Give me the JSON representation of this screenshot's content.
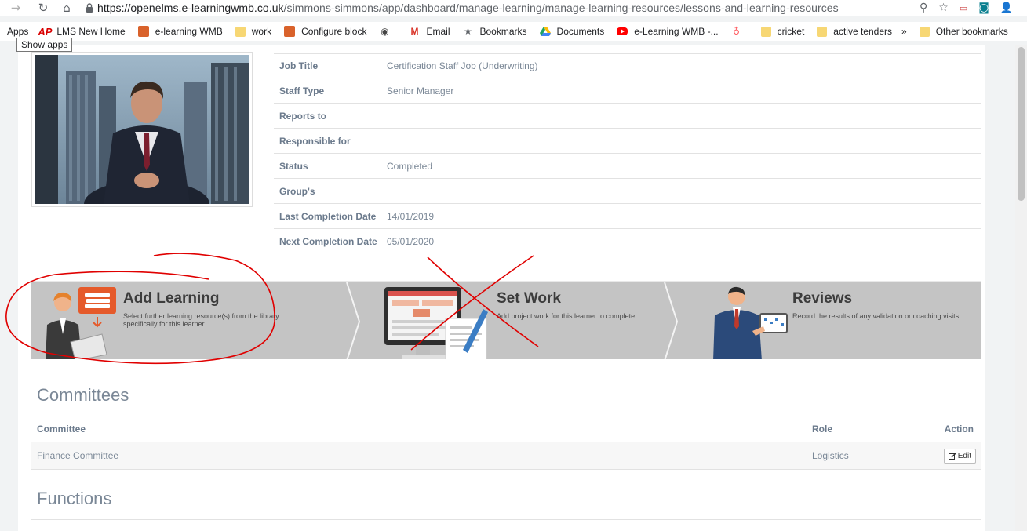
{
  "browser": {
    "url_host": "https://openelms.e-learningwmb.co.uk",
    "url_path": "/simmons-simmons/app/dashboard/manage-learning/manage-learning-resources/lessons-and-learning-resources",
    "bookmarks": [
      {
        "label": "Apps",
        "icon": "apps-icon"
      },
      {
        "label": "LMS New Home",
        "icon": "ap-logo-icon"
      },
      {
        "label": "e-learning WMB",
        "icon": "wmb-icon"
      },
      {
        "label": "work",
        "icon": "folder-icon"
      },
      {
        "label": "Configure block",
        "icon": "wmb-icon"
      },
      {
        "label": "",
        "icon": "globe-icon"
      },
      {
        "label": "Email",
        "icon": "gmail-icon"
      },
      {
        "label": "Bookmarks",
        "icon": "star-icon"
      },
      {
        "label": "Documents",
        "icon": "drive-icon"
      },
      {
        "label": "e-Learning WMB -...",
        "icon": "youtube-icon"
      },
      {
        "label": "",
        "icon": "airbnb-icon"
      },
      {
        "label": "cricket",
        "icon": "folder-icon"
      },
      {
        "label": "active tenders",
        "icon": "folder-icon"
      },
      {
        "label": "»",
        "icon": "more-icon"
      },
      {
        "label": "Other bookmarks",
        "icon": "folder-icon"
      }
    ],
    "tooltip": "Show apps"
  },
  "details": [
    {
      "label": "Job Title",
      "value": "Certification Staff Job (Underwriting)"
    },
    {
      "label": "Staff Type",
      "value": "Senior Manager"
    },
    {
      "label": "Reports to",
      "value": ""
    },
    {
      "label": "Responsible for",
      "value": ""
    },
    {
      "label": "Status",
      "value": "Completed"
    },
    {
      "label": "Group's",
      "value": ""
    },
    {
      "label": "Last Completion Date",
      "value": "14/01/2019"
    },
    {
      "label": "Next Completion Date",
      "value": "05/01/2020"
    }
  ],
  "actions": {
    "add_learning": {
      "title": "Add Learning",
      "desc": "Select further learning resource(s) from the library specifically for this learner."
    },
    "set_work": {
      "title": "Set Work",
      "desc": "Add project work for this learner to complete."
    },
    "reviews": {
      "title": "Reviews",
      "desc": "Record the results of any validation or coaching visits."
    }
  },
  "committees": {
    "title": "Committees",
    "headers": {
      "committee": "Committee",
      "role": "Role",
      "action": "Action"
    },
    "rows": [
      {
        "committee": "Finance Committee",
        "role": "Logistics",
        "action": "Edit"
      }
    ]
  },
  "functions": {
    "title": "Functions"
  },
  "colors": {
    "annotation_red": "#e00000",
    "banner_grey": "#c4c4c4",
    "label_slate": "#6b7a8c"
  }
}
